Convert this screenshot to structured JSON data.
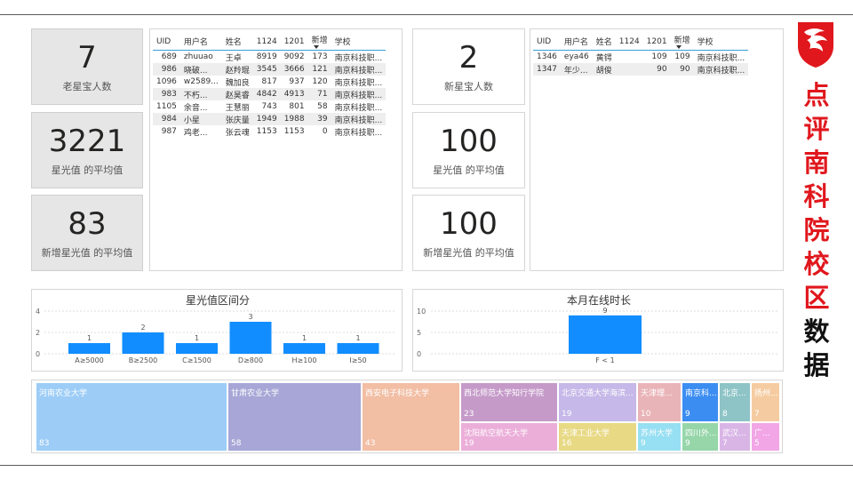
{
  "kpi_left": [
    {
      "value": "7",
      "label": "老星宝人数"
    },
    {
      "value": "3221",
      "label": "星光值 的平均值"
    },
    {
      "value": "83",
      "label": "新增星光值 的平均值"
    }
  ],
  "kpi_right": [
    {
      "value": "2",
      "label": "新星宝人数"
    },
    {
      "value": "100",
      "label": "星光值 的平均值"
    },
    {
      "value": "100",
      "label": "新增星光值 的平均值"
    }
  ],
  "table_old": {
    "columns": [
      "UID",
      "用户名",
      "姓名",
      "1124",
      "1201",
      "新增",
      "学校"
    ],
    "rows": [
      [
        "689",
        "zhuuao",
        "王卓",
        "8919",
        "9092",
        "173",
        "南京科技职..."
      ],
      [
        "986",
        "晓破...",
        "赵羚琨",
        "3545",
        "3666",
        "121",
        "南京科技职..."
      ],
      [
        "1096",
        "w2589...",
        "魏加良",
        "817",
        "937",
        "120",
        "南京科技职..."
      ],
      [
        "983",
        "不朽...",
        "赵昊睿",
        "4842",
        "4913",
        "71",
        "南京科技职..."
      ],
      [
        "1105",
        "余音...",
        "王慧丽",
        "743",
        "801",
        "58",
        "南京科技职..."
      ],
      [
        "984",
        "小星",
        "张庆量",
        "1949",
        "1988",
        "39",
        "南京科技职..."
      ],
      [
        "987",
        "鸡老...",
        "张云魂",
        "1153",
        "1153",
        "0",
        "南京科技职..."
      ]
    ]
  },
  "table_new": {
    "columns": [
      "UID",
      "用户名",
      "姓名",
      "1124",
      "1201",
      "新增",
      "学校"
    ],
    "rows": [
      [
        "1346",
        "eya46",
        "黄锷",
        "",
        "109",
        "109",
        "南京科技职..."
      ],
      [
        "1347",
        "年少...",
        "胡俊",
        "",
        "90",
        "90",
        "南京科技职..."
      ]
    ]
  },
  "chart_data": [
    {
      "type": "bar",
      "title": "星光值区间分",
      "categories": [
        "A≥5000",
        "B≥2500",
        "C≥1500",
        "D≥800",
        "H≥100",
        "I≥50"
      ],
      "values": [
        1,
        2,
        1,
        3,
        1,
        1
      ],
      "yticks": [
        "4",
        "2",
        "0"
      ],
      "ylim": [
        0,
        4
      ],
      "color": "#118dff"
    },
    {
      "type": "bar",
      "title": "本月在线时长",
      "categories": [
        "F < 1"
      ],
      "values": [
        9
      ],
      "yticks": [
        "10",
        "5",
        "0"
      ],
      "ylim": [
        0,
        10
      ],
      "color": "#118dff"
    }
  ],
  "treemap": [
    {
      "name": "河南农业大学",
      "value": "83",
      "color": "#9dcdf7"
    },
    {
      "name": "甘肃农业大学",
      "value": "58",
      "color": "#a7a6d6"
    },
    {
      "name": "西安电子科技大学",
      "value": "43",
      "color": "#f2bea4"
    },
    {
      "name": "西北师范大学知行学院",
      "value": "23",
      "color": "#c59ac9"
    },
    {
      "name": "沈阳航空航天大学",
      "value": "19",
      "color": "#ebaed9"
    },
    {
      "name": "北京交通大学海滨...",
      "value": "19",
      "color": "#c6b8e8"
    },
    {
      "name": "天津工业大学",
      "value": "16",
      "color": "#e8d985"
    },
    {
      "name": "天津理...",
      "value": "10",
      "color": "#e9b4b8"
    },
    {
      "name": "苏州大学",
      "value": "9",
      "color": "#97dff2"
    },
    {
      "name": "南京科...",
      "value": "9",
      "color": "#3b8df2"
    },
    {
      "name": "四川外...",
      "value": "9",
      "color": "#96d6a9"
    },
    {
      "name": "北京...",
      "value": "8",
      "color": "#8ec4c6"
    },
    {
      "name": "武汉...",
      "value": "7",
      "color": "#d9b5e6"
    },
    {
      "name": "扬州...",
      "value": "7",
      "color": "#f5cca1"
    },
    {
      "name": "广...",
      "value": "5",
      "color": "#f2a6e6"
    }
  ],
  "side_title": [
    "点",
    "评",
    "南",
    "科",
    "院",
    "校",
    "区",
    "数",
    "据"
  ],
  "side_title_colors": [
    "#e0171d",
    "#e0171d",
    "#e0171d",
    "#e0171d",
    "#e0171d",
    "#e0171d",
    "#e0171d",
    "#111111",
    "#111111"
  ],
  "logo_icon": "msi-dragon-shield-icon"
}
